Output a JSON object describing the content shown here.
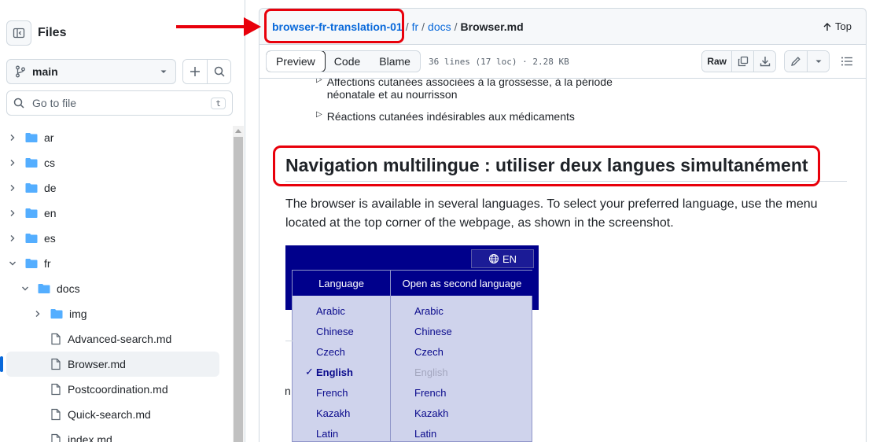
{
  "sidebar": {
    "title": "Files",
    "branch": "main",
    "goto_placeholder": "Go to file",
    "goto_shortcut": "t",
    "tree": [
      {
        "label": "ar",
        "type": "folder",
        "level": 0,
        "expanded": false
      },
      {
        "label": "cs",
        "type": "folder",
        "level": 0,
        "expanded": false
      },
      {
        "label": "de",
        "type": "folder",
        "level": 0,
        "expanded": false
      },
      {
        "label": "en",
        "type": "folder",
        "level": 0,
        "expanded": false
      },
      {
        "label": "es",
        "type": "folder",
        "level": 0,
        "expanded": false
      },
      {
        "label": "fr",
        "type": "folder",
        "level": 0,
        "expanded": true
      },
      {
        "label": "docs",
        "type": "folder",
        "level": 1,
        "expanded": true
      },
      {
        "label": "img",
        "type": "folder",
        "level": 2,
        "expanded": false
      },
      {
        "label": "Advanced-search.md",
        "type": "file",
        "level": 2
      },
      {
        "label": "Browser.md",
        "type": "file",
        "level": 2,
        "selected": true
      },
      {
        "label": "Postcoordination.md",
        "type": "file",
        "level": 2
      },
      {
        "label": "Quick-search.md",
        "type": "file",
        "level": 2
      },
      {
        "label": "index.md",
        "type": "file",
        "level": 2
      }
    ]
  },
  "breadcrumb": {
    "repo": "browser-fr-translation-01",
    "parts": [
      "fr",
      "docs"
    ],
    "current": "Browser.md",
    "top_label": "Top"
  },
  "toolbar": {
    "tabs": [
      "Preview",
      "Code",
      "Blame"
    ],
    "active_tab": "Preview",
    "file_info": "36 lines (17 loc) · 2.28 KB",
    "raw_label": "Raw"
  },
  "content": {
    "bullets": [
      "Affections cutanées associées à la grossesse, à la période néonatale et au nourrisson",
      "Réactions cutanées indésirables aux médicaments"
    ],
    "heading": "Navigation multilingue : utiliser deux langues simultanément",
    "paragraph": "The browser is available in several languages. To select your preferred language, use the menu located at the top corner of the webpage, as shown in the screenshot.",
    "stray_text": "n",
    "screenshot": {
      "lang_button": "EN",
      "col1_header": "Language",
      "col2_header": "Open as second language",
      "col1": [
        "Arabic",
        "Chinese",
        "Czech",
        "English",
        "French",
        "Kazakh",
        "Latin"
      ],
      "col2": [
        "Arabic",
        "Chinese",
        "Czech",
        "English",
        "French",
        "Kazakh",
        "Latin"
      ],
      "current_language": "English",
      "check_mark": "✓"
    }
  },
  "colors": {
    "accent": "#0969da",
    "annotation_red": "#e8000b",
    "menu_navy": "#00008b",
    "menu_bg": "#cfd3ec"
  }
}
